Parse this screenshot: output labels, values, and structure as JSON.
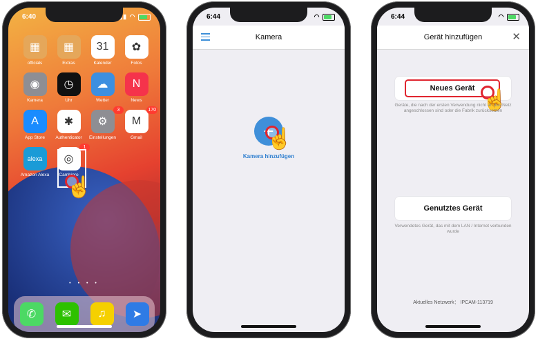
{
  "phone1": {
    "time": "6:40",
    "apps": [
      {
        "label": "officials",
        "icon": "folder-icon",
        "color": "#e5a75a",
        "glyph": "▦"
      },
      {
        "label": "Extras",
        "icon": "folder-icon",
        "color": "#e5a75a",
        "glyph": "▦"
      },
      {
        "label": "Kalender",
        "icon": "calendar-icon",
        "color": "#ffffff",
        "glyph": "31"
      },
      {
        "label": "Fotos",
        "icon": "photos-icon",
        "color": "#ffffff",
        "glyph": "✿"
      },
      {
        "label": "Kamera",
        "icon": "camera-icon",
        "color": "#8e8e93",
        "glyph": "◉"
      },
      {
        "label": "Uhr",
        "icon": "clock-icon",
        "color": "#111111",
        "glyph": "◷"
      },
      {
        "label": "Wetter",
        "icon": "weather-icon",
        "color": "#3d8fe0",
        "glyph": "☁"
      },
      {
        "label": "News",
        "icon": "news-icon",
        "color": "#f5334b",
        "glyph": "N"
      },
      {
        "label": "App Store",
        "icon": "app-store-icon",
        "color": "#1a8cff",
        "glyph": "A"
      },
      {
        "label": "Authenticator",
        "icon": "authenticator-icon",
        "color": "#ffffff",
        "glyph": "✱"
      },
      {
        "label": "Einstellungen",
        "icon": "settings-icon",
        "color": "#8e8e93",
        "glyph": "⚙",
        "badge": "3"
      },
      {
        "label": "Gmail",
        "icon": "gmail-icon",
        "color": "#ffffff",
        "glyph": "M",
        "badge": "170"
      },
      {
        "label": "Amazon Alexa",
        "icon": "alexa-icon",
        "color": "#1a9bd7",
        "glyph": "alexa"
      },
      {
        "label": "Camhipro",
        "icon": "camhipro-icon",
        "color": "#ffffff",
        "glyph": "◎",
        "badge": "1"
      }
    ],
    "calendar_day": "MI",
    "dots": "• • • •",
    "dock": [
      {
        "icon": "phone-icon",
        "color": "#4cd964",
        "glyph": "✆"
      },
      {
        "icon": "wechat-icon",
        "color": "#2dc100",
        "glyph": "✉"
      },
      {
        "icon": "music-icon",
        "color": "#f5d000",
        "glyph": "♫"
      },
      {
        "icon": "paper-plane-icon",
        "color": "#2f7be5",
        "glyph": "➤"
      }
    ]
  },
  "phone2": {
    "time": "6:44",
    "title": "Kamera",
    "add_glyph": "+",
    "add_label": "Kamera hinzufügen"
  },
  "phone3": {
    "time": "6:44",
    "title": "Gerät hinzufügen",
    "close_glyph": "✕",
    "new_device": "Neues Gerät",
    "new_device_desc": "Geräte, die nach der ersten Verwendung nicht an das Netz angeschlossen sind oder die Fabrik zurücksetzen",
    "used_device": "Genutztes Gerät",
    "used_device_desc": "Verwendetes Gerät, das mit dem LAN / Internet verbunden wurde",
    "network": "Aktuelles Netzwerk： IPCAM-113719"
  },
  "accent": "#3f8fd9",
  "highlight": "#e0252f"
}
